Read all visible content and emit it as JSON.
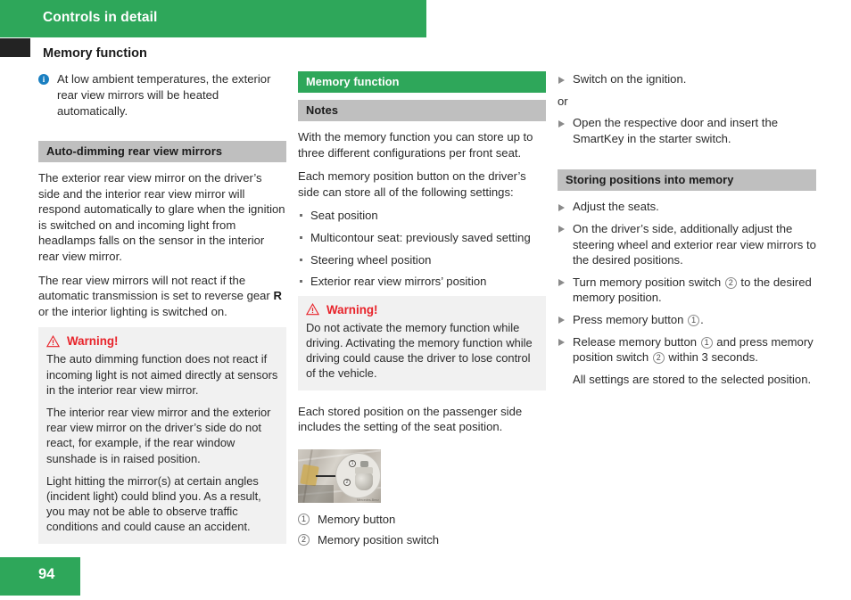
{
  "header": {
    "chapter_title": "Controls in detail",
    "section_title": "Memory function",
    "chapter_bar_color": "#2ea75a",
    "tab_color": "#232323"
  },
  "footer": {
    "page_number": "94",
    "bar_color": "#2ea75a"
  },
  "colors": {
    "green": "#2ea75a",
    "grey_heading": "#bfbfbf",
    "warning_red": "#e8232a",
    "warning_box_bg": "#f1f1f1",
    "info_blue": "#1a7fc1"
  },
  "left_column": {
    "note": {
      "icon": "info-icon",
      "text": "At low ambient temperatures, the exterior rear view mirrors will be heated automatically."
    },
    "heading": "Auto-dimming rear view mirrors",
    "paragraph_1": "The exterior rear view mirror on the driver’s side and the interior rear view mirror will respond automatically to glare when the ignition is switched on and incoming light from headlamps falls on the sensor in the interior rear view mirror.",
    "paragraph_2_pre": "The rear view mirrors will not react if the automatic transmission is set to reverse gear ",
    "paragraph_2_bold": "R",
    "paragraph_2_post": " or the interior lighting is switched on.",
    "warning": {
      "icon": "warning-triangle-icon",
      "label": "Warning!",
      "paragraphs": [
        "The auto dimming function does not react if incoming light is not aimed directly at sensors in the interior rear view mirror.",
        "The interior rear view mirror and the exterior rear view mirror on the driver’s side do not react, for example, if the rear window sunshade is in raised position.",
        "Light hitting the mirror(s) at certain angles (incident light) could blind you. As a result, you may not be able to observe traffic conditions and could cause an accident."
      ]
    }
  },
  "middle_column": {
    "green_heading": "Memory function",
    "grey_heading": "Notes",
    "paragraph_1": "With the memory function you can store up to three different configurations per front seat.",
    "paragraph_2": "Each memory position button on the driver’s side can store all of the following settings:",
    "settings_list": [
      "Seat position",
      "Multicontour seat: previously saved setting",
      "Steering wheel position",
      "Exterior rear view mirrors’ position"
    ],
    "warning": {
      "icon": "warning-triangle-icon",
      "label": "Warning!",
      "paragraphs": [
        "Do not activate the memory function while driving. Activating the memory function while driving could cause the driver to lose control of the vehicle."
      ]
    },
    "paragraph_3": "Each stored position on the passenger side includes the setting of the seat position.",
    "figure": {
      "name": "memory-button-and-switch-photo",
      "credit": "Mercedes-Benz"
    },
    "captions": [
      {
        "number": "1",
        "label": "Memory button"
      },
      {
        "number": "2",
        "label": "Memory position switch"
      }
    ]
  },
  "right_column": {
    "steps_top": [
      {
        "type": "step",
        "text": "Switch on the ignition."
      },
      {
        "type": "or",
        "text": "or"
      },
      {
        "type": "step",
        "text": "Open the respective door and insert the SmartKey in the starter switch."
      }
    ],
    "heading": "Storing positions into memory",
    "steps": [
      {
        "type": "step",
        "segments": [
          {
            "t": "Adjust the seats."
          }
        ]
      },
      {
        "type": "step",
        "segments": [
          {
            "t": "On the driver’s side, additionally adjust the steering wheel and exterior rear view mirrors to the desired positions."
          }
        ]
      },
      {
        "type": "step",
        "segments": [
          {
            "t": "Turn memory position switch "
          },
          {
            "circ": "2"
          },
          {
            "t": " to the desired memory position."
          }
        ]
      },
      {
        "type": "step",
        "segments": [
          {
            "t": "Press memory button "
          },
          {
            "circ": "1"
          },
          {
            "t": "."
          }
        ]
      },
      {
        "type": "step",
        "segments": [
          {
            "t": "Release memory button "
          },
          {
            "circ": "1"
          },
          {
            "t": " and press memory position switch "
          },
          {
            "circ": "2"
          },
          {
            "t": " within 3 seconds."
          }
        ]
      },
      {
        "type": "note",
        "segments": [
          {
            "t": "All settings are stored to the selected position."
          }
        ]
      }
    ]
  }
}
